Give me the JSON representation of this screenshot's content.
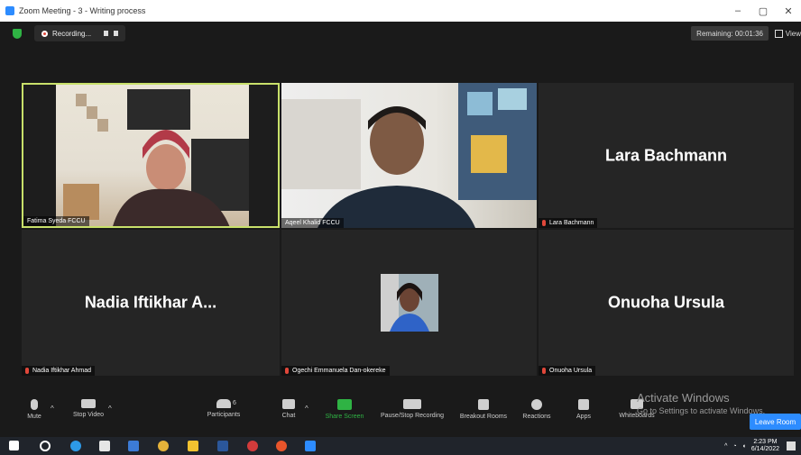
{
  "window": {
    "title": "Zoom Meeting - 3 - Writing process",
    "controls": [
      "–",
      "▢",
      "✕"
    ]
  },
  "topbar": {
    "recording_label": "Recording...",
    "remaining": "Remaining: 00:01:36",
    "view_label": "View"
  },
  "participants": [
    {
      "name": "Fatima Syeda FCCU"
    },
    {
      "name": "Aqeel Khalid FCCU"
    },
    {
      "name": "Lara Bachmann",
      "display": "Lara Bachmann"
    },
    {
      "name": "Nadia Iftikhar Ahmad",
      "display": "Nadia Iftikhar A..."
    },
    {
      "name": "Ogechi Emmanuela Dan-okereke"
    },
    {
      "name": "Onuoha Ursula",
      "display": "Onuoha Ursula"
    }
  ],
  "toolbar": {
    "mute": "Mute",
    "stop_video": "Stop Video",
    "participants": "Participants",
    "participants_count": "6",
    "chat": "Chat",
    "share_screen": "Share Screen",
    "pause_recording": "Pause/Stop Recording",
    "breakout": "Breakout Rooms",
    "reactions": "Reactions",
    "apps": "Apps",
    "whiteboards": "Whiteboards",
    "leave": "Leave Room"
  },
  "activate": {
    "line1": "Activate Windows",
    "line2": "Go to Settings to activate Windows."
  },
  "taskbar": {
    "time": "2:23 PM",
    "date": "6/14/2022"
  },
  "colors": {
    "accent": "#2d8cff",
    "share": "#2fb344",
    "active_border": "#c8e06a",
    "muted": "#e0473a"
  }
}
